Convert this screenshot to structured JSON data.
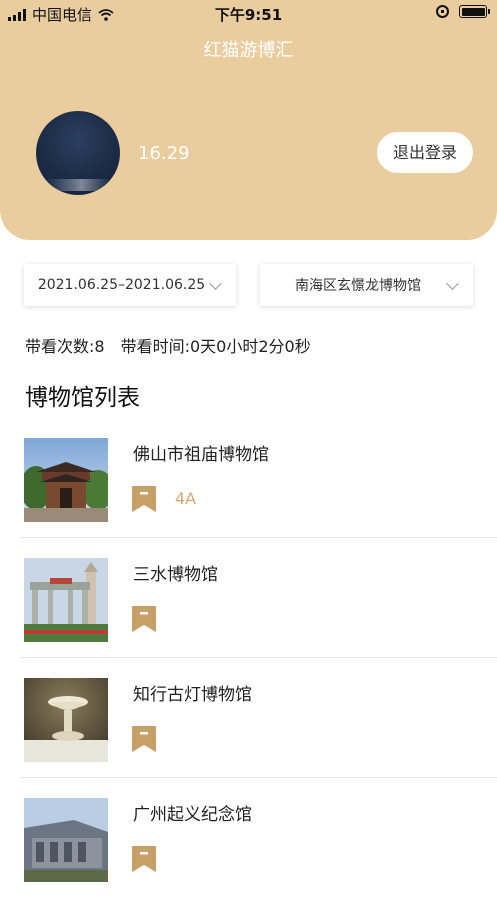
{
  "status_bar": {
    "carrier": "中国电信",
    "time": "下午9:51"
  },
  "header": {
    "title": "红猫游博汇",
    "username": "16.29",
    "logout_label": "退出登录"
  },
  "filters": {
    "date_range": "2021.06.25–2021.06.25",
    "museum": "南海区玄憬龙博物馆"
  },
  "stats": {
    "visit_count": "带看次数:8",
    "visit_time": "带看时间:0天0小时2分0秒"
  },
  "section_title": "博物馆列表",
  "museums": [
    {
      "name": "佛山市祖庙博物馆",
      "level": "4A"
    },
    {
      "name": "三水博物馆",
      "level": ""
    },
    {
      "name": "知行古灯博物馆",
      "level": ""
    },
    {
      "name": "广州起义纪念馆",
      "level": ""
    }
  ],
  "colors": {
    "header_bg": "#e9cd9f",
    "bookmark": "#c7a067",
    "level_text": "#d4a978"
  }
}
